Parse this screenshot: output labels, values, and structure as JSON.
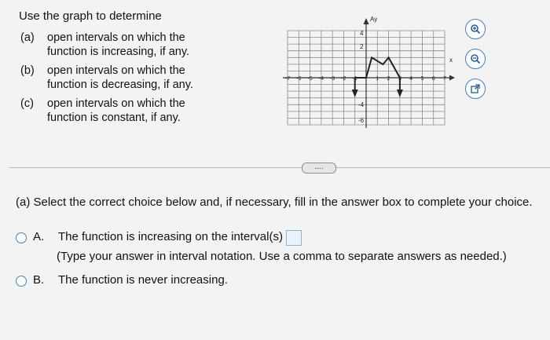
{
  "prompt": {
    "intro": "Use the graph to determine",
    "items": [
      {
        "letter": "(a)",
        "text": "open intervals on which the function is increasing, if any."
      },
      {
        "letter": "(b)",
        "text": "open intervals on which the function is decreasing, if any."
      },
      {
        "letter": "(c)",
        "text": "open intervals on which the function is constant, if any."
      }
    ]
  },
  "graph": {
    "y_axis_label": "Ay",
    "x_axis_label": "x",
    "y_tick_labels": [
      "4",
      "2",
      "-4",
      "-6"
    ],
    "x_tick_labels": [
      "-7",
      "-6",
      "-5",
      "-4",
      "-3",
      "-2",
      "-1",
      "1",
      "2",
      "3",
      "4",
      "5",
      "6",
      "7"
    ]
  },
  "icons": [
    "zoom-in-icon",
    "zoom-out-icon",
    "external-link-icon"
  ],
  "more_button": "....",
  "part_a": {
    "prompt": "(a) Select the correct choice below and, if necessary, fill in the answer box to complete your choice.",
    "choices": [
      {
        "letter": "A.",
        "text": "The function is increasing on the interval(s)",
        "hint": "(Type your answer in interval notation. Use a comma to separate answers as needed.)"
      },
      {
        "letter": "B.",
        "text": "The function is never increasing."
      }
    ]
  }
}
